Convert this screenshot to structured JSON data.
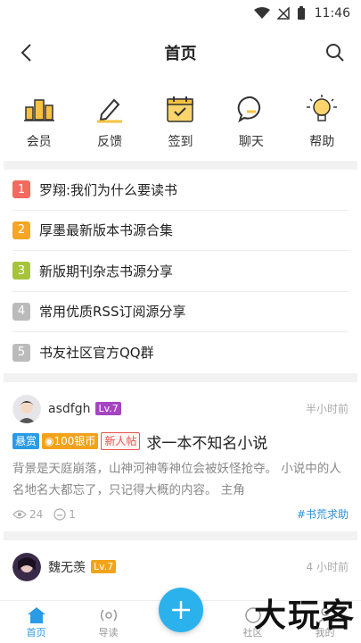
{
  "status_bar": {
    "time": "11:46"
  },
  "header": {
    "title": "首页"
  },
  "quick_actions": [
    {
      "label": "会员",
      "icon": "vip-icon"
    },
    {
      "label": "反馈",
      "icon": "edit-icon"
    },
    {
      "label": "签到",
      "icon": "calendar-check-icon"
    },
    {
      "label": "聊天",
      "icon": "chat-icon"
    },
    {
      "label": "帮助",
      "icon": "lightbulb-icon"
    }
  ],
  "notices": [
    {
      "num": "1",
      "text": "罗翔:我们为什么要读书",
      "color": "#f36a5e"
    },
    {
      "num": "2",
      "text": "厚墨最新版本书源合集",
      "color": "#f5a623"
    },
    {
      "num": "3",
      "text": "新版期刊杂志书源分享",
      "color": "#a6c43a"
    },
    {
      "num": "4",
      "text": "常用优质RSS订阅源分享",
      "color": "#bbbbbb"
    },
    {
      "num": "5",
      "text": "书友社区官方QQ群",
      "color": "#bbbbbb"
    }
  ],
  "posts": [
    {
      "username": "asdfgh",
      "level": "Lv.7",
      "time": "半小时前",
      "tags": {
        "bounty": "悬赏",
        "coin": "100银币",
        "new": "新人帖"
      },
      "title": "求一本不知名小说",
      "body": "背景是天庭崩落，山神河神等神位会被妖怪抢夺。 小说中的人名地名大都忘了，只记得大概的内容。 主角",
      "views": "24",
      "comments": "1",
      "topic": "#书荒求助"
    },
    {
      "username": "魏无羡",
      "level": "Lv.7",
      "time": "4 小时前"
    }
  ],
  "bottom_nav": {
    "home": "首页",
    "guide": "导读",
    "community": "社区",
    "mine": "我的"
  },
  "watermark": "大玩客"
}
